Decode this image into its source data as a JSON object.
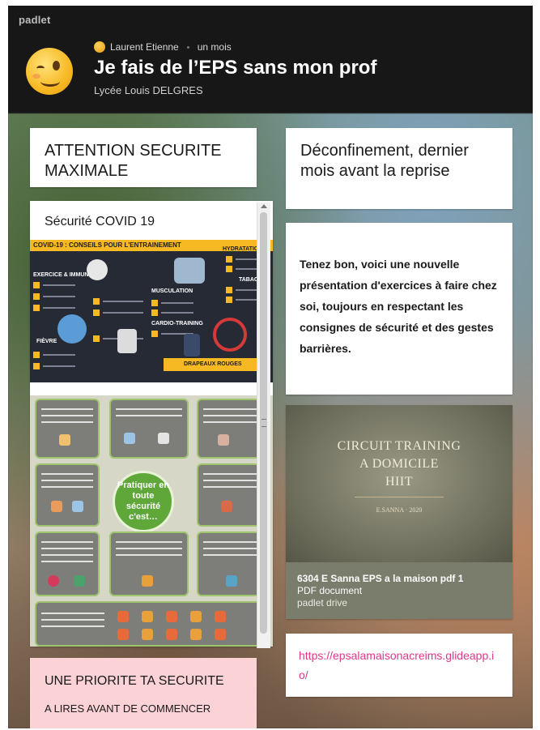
{
  "header": {
    "brand": "padlet",
    "author": "Laurent Etienne",
    "time": "un mois",
    "title": "Je fais de l’EPS sans mon prof",
    "subtitle": "Lycée Louis DELGRES"
  },
  "sections": {
    "left": "ATTENTION SECURITE MAXIMALE",
    "right": "Déconfinement, dernier mois avant la reprise"
  },
  "posts": {
    "covid_title": "Sécurité COVID 19",
    "priority_title": "UNE PRIORITE TA SECURITE",
    "priority_sub": "A LIRES AVANT DE COMMENCER",
    "message": "Tenez bon, voici une nouvelle présentation d'exercices à faire chez soi, toujours en respectant les consignes de sécurité et des gestes barrières.",
    "link": "https://epsalamaisonacreims.glideapp.io/"
  },
  "infographic": {
    "banner": "COVID-19 : CONSEILS POUR L'ENTRAINEMENT",
    "labels": [
      "EXERCICE & IMMUNITÉ",
      "HYDRATATION",
      "TABAC",
      "MUSCULATION",
      "CARDIO-TRAINING",
      "FIÈVRE",
      "DRAPEAUX ROUGES"
    ],
    "center": "Pratiquer en toute sécurité c'est…"
  },
  "attachment": {
    "slide_line1": "CIRCUIT TRAINING",
    "slide_line2": "A DOMICILE",
    "slide_line3": "HIIT",
    "slide_author": "E.SANNA · 2020",
    "name": "6304 E Sanna EPS a la maison pdf 1",
    "type": "PDF document",
    "source": "padlet drive"
  }
}
